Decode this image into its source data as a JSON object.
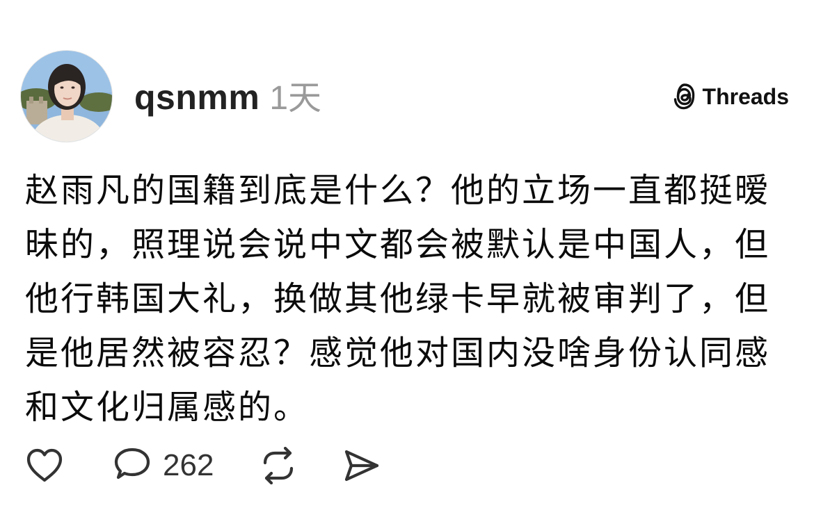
{
  "post": {
    "author": {
      "username": "qsnmm",
      "avatar_icon": "profile-photo"
    },
    "timestamp": "1天",
    "brand": {
      "name": "Threads",
      "icon": "threads-logo-icon"
    },
    "text": "赵雨凡的国籍到底是什么？他的立场一直都挺暧昧的，照理说会说中文都会被默认是中国人，但他行韩国大礼，换做其他绿卡早就被审判了，但是他居然被容忍？感觉他对国内没啥身份认同感和文化归属感的。",
    "actions": {
      "like_icon": "heart-icon",
      "reply_icon": "comment-bubble-icon",
      "reply_count": "262",
      "repost_icon": "repost-icon",
      "share_icon": "send-icon"
    }
  }
}
